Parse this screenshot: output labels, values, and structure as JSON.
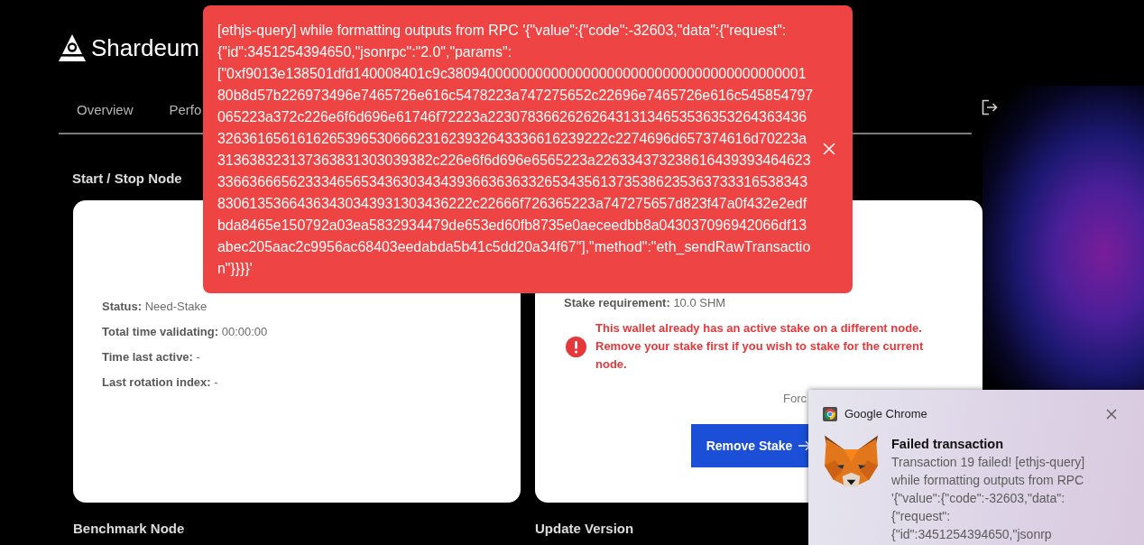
{
  "header": {
    "logo_text": "Shardeum",
    "tabs": [
      {
        "label": "Overview",
        "selected": false
      },
      {
        "label": "Perfo",
        "selected": false
      }
    ]
  },
  "start_stop": {
    "heading": "Start / Stop Node",
    "node_status": [
      {
        "text": "**Status:** Need-Stake"
      },
      {
        "text": "**Total time validating:** 00:00:00"
      },
      {
        "text": "**Time last active:** -"
      },
      {
        "text": "**Last rotation index:** -"
      }
    ],
    "stake": {
      "requirement": "**Stake requirement:** 10.0 SHM",
      "warning": "This wallet already has an active stake on a different node. Remove your stake first if you wish to stake for the current node.",
      "force_label": "Forc",
      "button": "Remove Stake"
    }
  },
  "lower_headings": [
    "Benchmark Node",
    "Update Version"
  ],
  "error_toast": {
    "message": "[ethjs-query] while formatting outputs from RPC '{\"value\":{\"code\":-32603,\"data\":{\"request\":{\"id\":3451254394650,\"jsonrpc\":\"2.0\",\"params\":[\"0xf9013e138501dfd140008401c9c38094000000000000000000000000000000000000000180b8d57b226973496e7465726e616c5478223a747275652c22696e7465726e616c545854797065223a372c226e6f6d696e61746f72223a22307836626262643131346535363532643634363263616561616265396530666231623932643336616239222c2274696d657374616d70223a313638323137363831303039382c226e6f6d696e6565223a2263343732386164393934646233366366656233346565343630343439366363633265343561373538623536373331653834383061353664363430343931303436222c22666f726365223a747275657d823f47a0f432e2edfbda8465e150792a03ea5832934479de653ed60fb8735e0aeceedbb8a043037096942066df13abec205aac2c9956ac68403eedabda5b41c5dd20a34f67\"],\"method\":\"eth_sendRawTransaction\"}}}}'"
  },
  "notification": {
    "app": "Google Chrome",
    "title": "Failed transaction",
    "body": "Transaction 19 failed! [ethjs-query] while formatting outputs from RPC '{\"value\":{\"code\":-32603,\"data\":{\"request\":{\"id\":3451254394650,\"jsonrp"
  }
}
